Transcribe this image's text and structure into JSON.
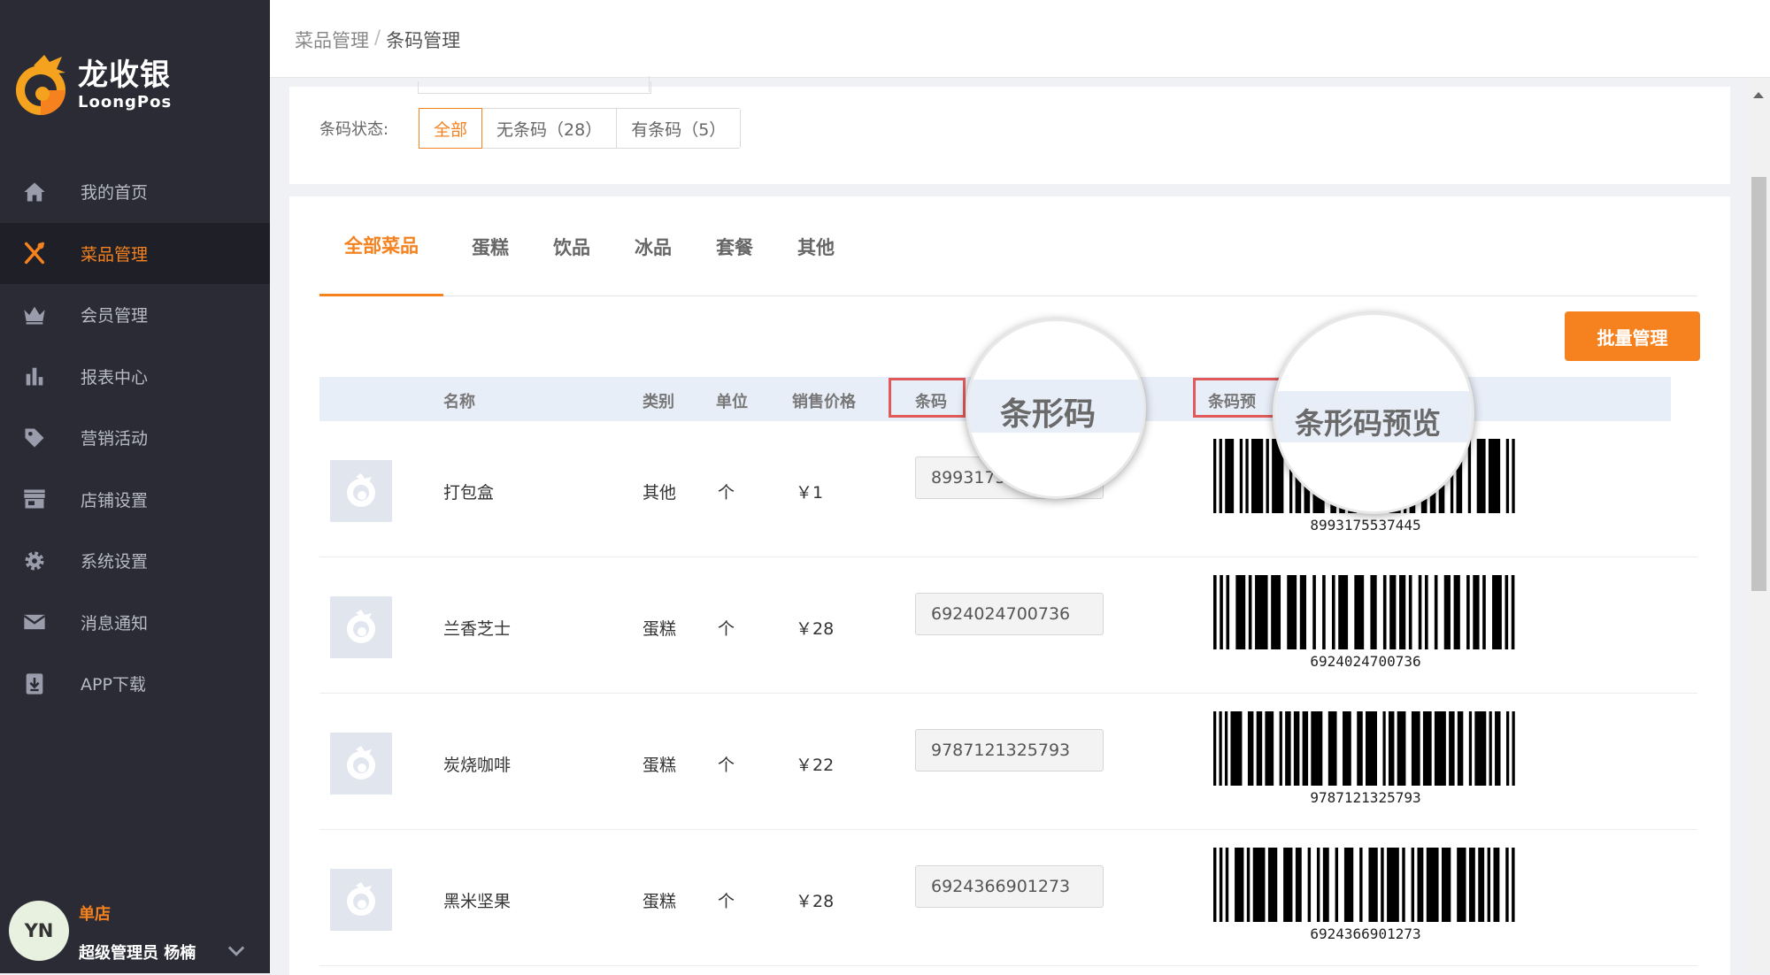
{
  "brand": {
    "name_cn": "龙收银",
    "name_en": "LoongPos",
    "accent": "#f5821f"
  },
  "sidebar": {
    "items": [
      {
        "label": "我的首页",
        "icon": "home-icon"
      },
      {
        "label": "菜品管理",
        "icon": "utensils-icon",
        "active": true
      },
      {
        "label": "会员管理",
        "icon": "crown-icon"
      },
      {
        "label": "报表中心",
        "icon": "bar-chart-icon"
      },
      {
        "label": "营销活动",
        "icon": "tag-icon"
      },
      {
        "label": "店铺设置",
        "icon": "store-icon"
      },
      {
        "label": "系统设置",
        "icon": "gear-icon"
      },
      {
        "label": "消息通知",
        "icon": "mail-icon"
      },
      {
        "label": "APP下载",
        "icon": "download-icon"
      }
    ]
  },
  "user": {
    "initials": "YN",
    "store": "单店",
    "role_name": "超级管理员  杨楠"
  },
  "breadcrumb": {
    "parent": "菜品管理",
    "separator": "/",
    "current": "条码管理"
  },
  "filter": {
    "label": "条码状态:",
    "options": [
      "全部",
      "无条码（28）",
      "有条码（5）"
    ],
    "selected": "全部"
  },
  "tabs": [
    "全部菜品",
    "蛋糕",
    "饮品",
    "冰品",
    "套餐",
    "其他"
  ],
  "batch_button": "批量管理",
  "table": {
    "headers": {
      "name": "名称",
      "category": "类别",
      "unit": "单位",
      "price": "销售价格",
      "barcode": "条码",
      "preview": "条码预"
    },
    "rows": [
      {
        "name": "打包盒",
        "category": "其他",
        "unit": "个",
        "price": "￥1",
        "barcode": "89931755",
        "barcode_full": "8993175537445"
      },
      {
        "name": "兰香芝士",
        "category": "蛋糕",
        "unit": "个",
        "price": "￥28",
        "barcode": "6924024700736",
        "barcode_full": "6924024700736"
      },
      {
        "name": "炭烧咖啡",
        "category": "蛋糕",
        "unit": "个",
        "price": "￥22",
        "barcode": "9787121325793",
        "barcode_full": "9787121325793"
      },
      {
        "name": "黑米坚果",
        "category": "蛋糕",
        "unit": "个",
        "price": "￥28",
        "barcode": "6924366901273",
        "barcode_full": "6924366901273"
      }
    ]
  },
  "magnifiers": {
    "barcode": "条形码",
    "preview": "条形码预览"
  }
}
